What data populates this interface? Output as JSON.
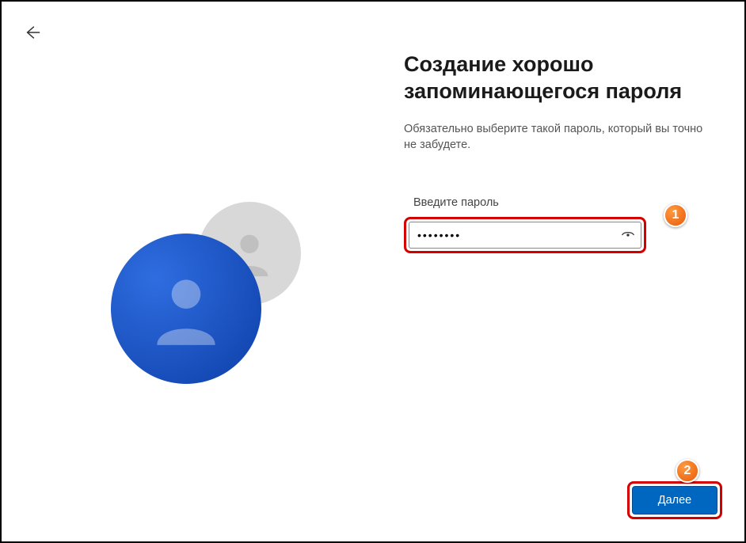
{
  "header": {
    "title": "Создание хорошо запоминающегося пароля",
    "subtitle": "Обязательно выберите такой пароль, который вы точно не забудете."
  },
  "form": {
    "password_label": "Введите пароль",
    "password_value": "••••••••"
  },
  "actions": {
    "next_label": "Далее"
  },
  "annotations": {
    "badge1": "1",
    "badge2": "2"
  },
  "colors": {
    "accent": "#0067c0",
    "highlight_border": "#d40000",
    "badge_bg": "#f76707"
  }
}
